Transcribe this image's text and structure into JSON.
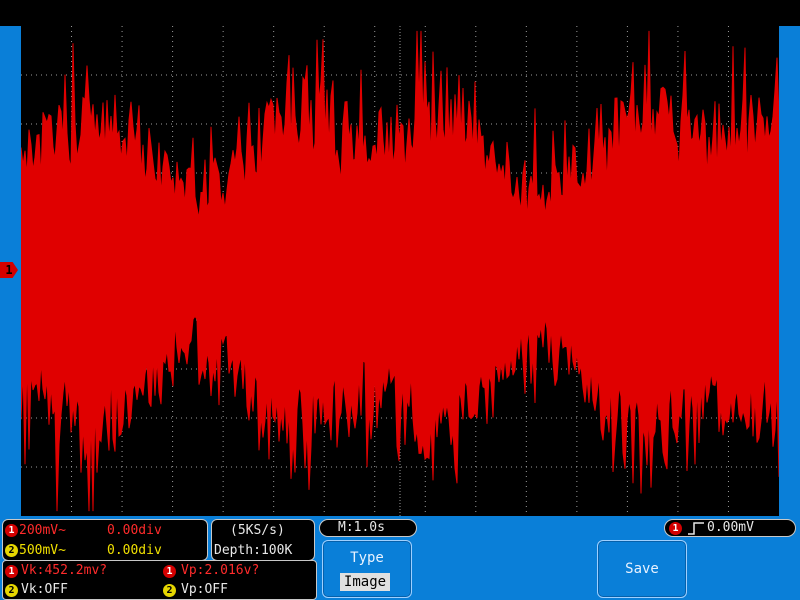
{
  "channels": {
    "ch1": {
      "marker": "1",
      "scale": "200mV~",
      "position": "0.00div",
      "color": "#d40000"
    },
    "ch2": {
      "marker": "2",
      "scale": "500mV~",
      "position": "0.00div",
      "color": "#e6d600"
    }
  },
  "acquisition": {
    "rate": "(5KS/s)",
    "depth": "Depth:100K"
  },
  "timebase": {
    "label": "M:1.0s"
  },
  "trigger": {
    "channel": "1",
    "level": "0.00mV"
  },
  "measurements": {
    "ch1_vk": "Vk:452.2mv?",
    "ch1_vp": "Vp:2.016v?",
    "ch2_vk": "Vk:OFF",
    "ch2_vp": "Vp:OFF"
  },
  "menu": {
    "type_label": "Type",
    "type_value": "Image",
    "save_label": "Save"
  },
  "colors": {
    "panel_blue": "#0a7fd8",
    "trace": "#e00000",
    "grid": "#9a9a9a"
  }
}
